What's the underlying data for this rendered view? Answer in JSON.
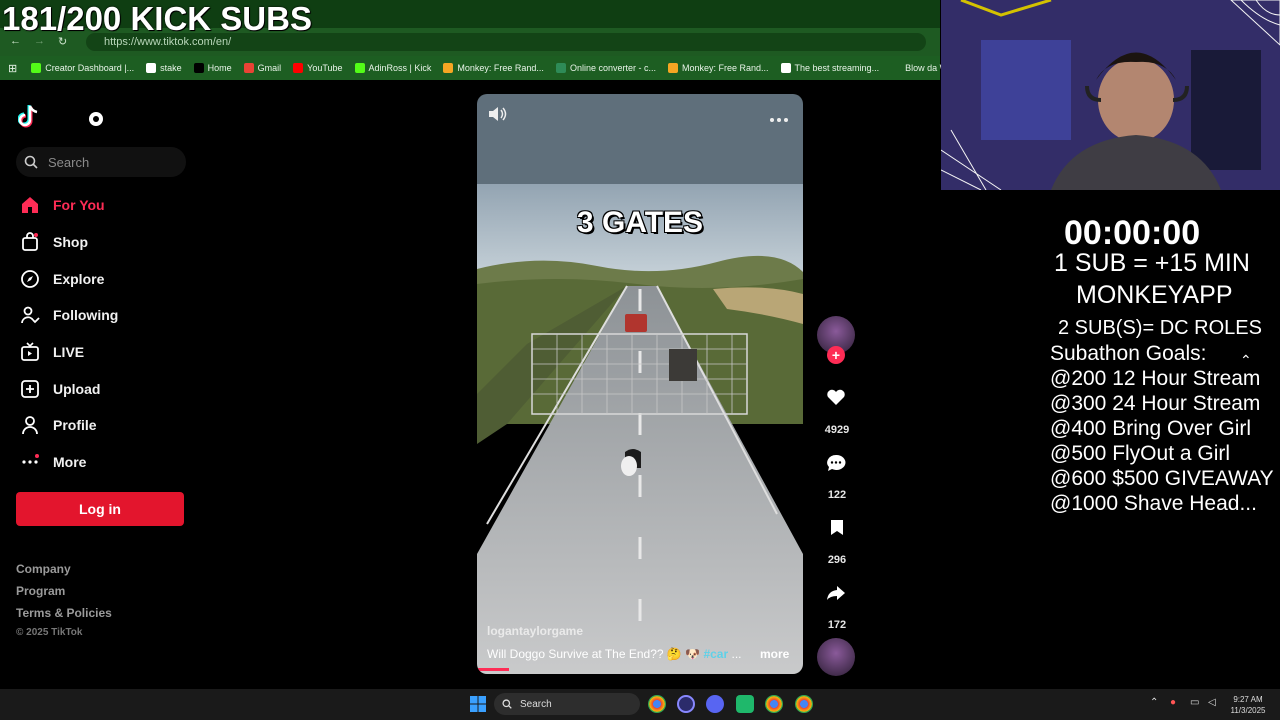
{
  "overlay": {
    "kick_subs": "181/200 KICK SUBS",
    "timer": "00:00:00",
    "rate_line1": "1 SUB = +15 MIN",
    "rate_line2": "MONKEYAPP",
    "dc_roles": "2 SUB(S)= DC ROLES",
    "goals_title": "Subathon Goals:",
    "goals": [
      "@200 12 Hour Stream",
      "@300 24 Hour Stream",
      "@400 Bring Over Girl",
      "@500 FlyOut a Girl",
      "@600 $500 GIVEAWAY",
      "@1000 Shave Head..."
    ]
  },
  "browser": {
    "url": "https://www.tiktok.com/en/",
    "bookmarks": [
      {
        "label": "Creator Dashboard |...",
        "icon": "kick-icon",
        "color": "#53fc18"
      },
      {
        "label": "stake",
        "icon": "stake-icon",
        "color": "#ffffff"
      },
      {
        "label": "Home",
        "icon": "x-icon",
        "color": "#000000"
      },
      {
        "label": "Gmail",
        "icon": "gmail-icon",
        "color": "#ea4335"
      },
      {
        "label": "YouTube",
        "icon": "youtube-icon",
        "color": "#ff0000"
      },
      {
        "label": "AdinRoss | Kick",
        "icon": "kick-icon",
        "color": "#53fc18"
      },
      {
        "label": "Monkey: Free Rand...",
        "icon": "monkey-icon",
        "color": "#f5a623"
      },
      {
        "label": "Online converter - c...",
        "icon": "converter-icon",
        "color": "#2e8b57"
      },
      {
        "label": "Monkey: Free Rand...",
        "icon": "monkey-icon",
        "color": "#f5a623"
      },
      {
        "label": "The best streaming...",
        "icon": "streaming-icon",
        "color": "#ffffff"
      },
      {
        "label": "Blow da Whistle - lil...",
        "icon": "music-icon",
        "color": "#1d5e22"
      }
    ]
  },
  "tiktok": {
    "search_placeholder": "Search",
    "nav": [
      {
        "label": "For You",
        "icon": "home-icon",
        "active": true
      },
      {
        "label": "Shop",
        "icon": "shop-icon"
      },
      {
        "label": "Explore",
        "icon": "compass-icon"
      },
      {
        "label": "Following",
        "icon": "following-icon"
      },
      {
        "label": "LIVE",
        "icon": "live-icon"
      },
      {
        "label": "Upload",
        "icon": "upload-icon"
      },
      {
        "label": "Profile",
        "icon": "profile-icon"
      },
      {
        "label": "More",
        "icon": "more-icon"
      }
    ],
    "login_label": "Log in",
    "footer": {
      "company": "Company",
      "program": "Program",
      "terms": "Terms & Policies",
      "copyright": "© 2025 TikTok"
    },
    "video": {
      "title": "3 GATES",
      "username": "logantaylorgame",
      "caption": "Will Doggo Survive at The End?? 🤔 🐶",
      "hashtag": "#car",
      "ellipsis": "...",
      "more_label": "more"
    },
    "actions": {
      "likes": "4929",
      "comments": "122",
      "saves": "296",
      "shares": "172"
    }
  },
  "taskbar": {
    "search_placeholder": "Search",
    "time": "9:27 AM",
    "date": "11/3/2025"
  },
  "colors": {
    "accent": "#fe2c55",
    "login": "#e3152d",
    "chrome_green": "#1d5e22"
  }
}
